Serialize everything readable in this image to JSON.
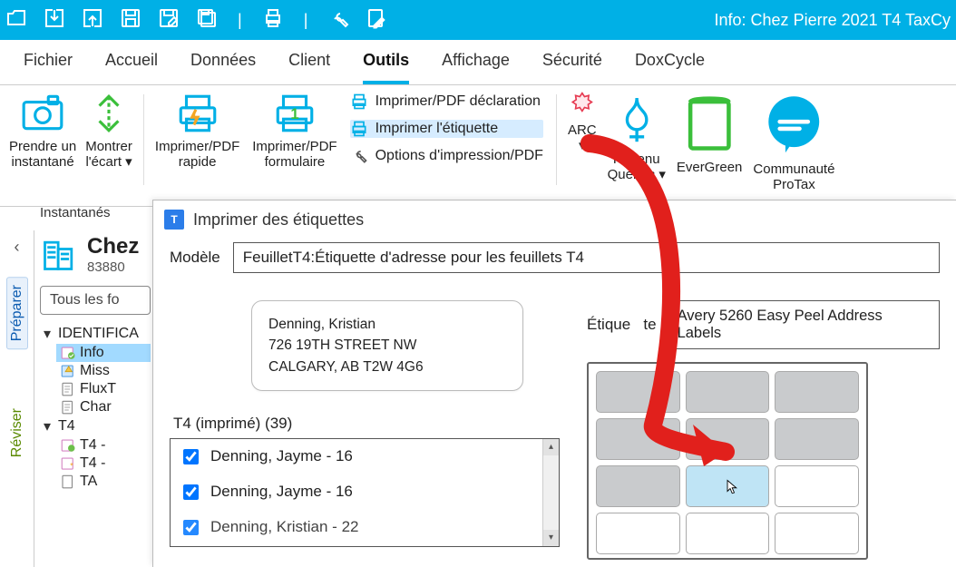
{
  "titlebar": {
    "title": "Info: Chez Pierre 2021 T4 TaxCy"
  },
  "menu": {
    "fichier": "Fichier",
    "accueil": "Accueil",
    "donnees": "Données",
    "client": "Client",
    "outils": "Outils",
    "affichage": "Affichage",
    "securite": "Sécurité",
    "doxcycle": "DoxCycle"
  },
  "ribbon": {
    "prendre": "Prendre un\ninstantané",
    "montrer": "Montrer\nl'écart ▾",
    "instantanes_caption": "Instantanés",
    "rapide": "Imprimer/PDF\nrapide",
    "formulaire": "Imprimer/PDF\nformulaire",
    "tool1": "Imprimer/PDF déclaration",
    "tool2": "Imprimer l'étiquette",
    "tool3": "Options d'impression/PDF",
    "arc": "ARC\n▾",
    "rq": "Revenu\nQuébec ▾",
    "evergreen": "EverGreen",
    "commun": "Communauté\nProTax"
  },
  "org": {
    "name": "Chez",
    "sub": "83880"
  },
  "search_placeholder": "Tous les fo",
  "tree": {
    "ident": "IDENTIFICA",
    "info": "Info",
    "miss": "Miss",
    "flux": "FluxT",
    "char": "Char",
    "t4": "T4",
    "t4a": "T4 -",
    "t4b": "T4 -",
    "t4c": "TA"
  },
  "vtabs": {
    "preparer": "Préparer",
    "reviser": "Réviser"
  },
  "dialog": {
    "title": "Imprimer des étiquettes",
    "model_label": "Modèle",
    "model_value": "FeuilletT4:Étiquette d'adresse pour les feuillets T4",
    "addr_line1": "Denning, Kristian",
    "addr_line2": "726 19TH STREET NW",
    "addr_line3": "CALGARY, AB T2W 4G6",
    "list_caption": "T4 (imprimé) (39)",
    "list": [
      "Denning, Jayme - 16",
      "Denning, Jayme - 16",
      "Denning, Kristian - 22"
    ],
    "etq_label": "Étique   te",
    "etq_value": "Avery 5260 Easy Peel Address Labels"
  }
}
